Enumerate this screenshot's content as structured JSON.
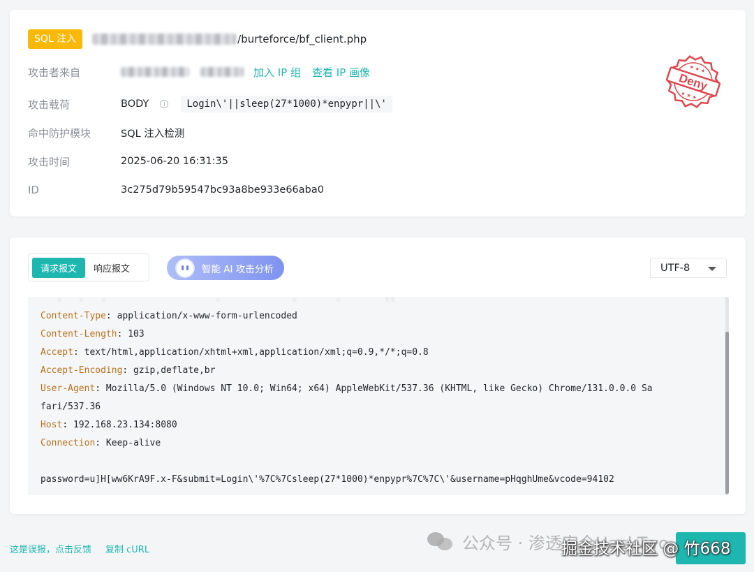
{
  "header": {
    "badge": "SQL 注入",
    "url_path": "/burteforce/bf_client.php"
  },
  "details": {
    "source": {
      "label": "攻击者来自",
      "add_ip_group": "加入 IP 组",
      "view_ip_profile": "查看 IP 画像"
    },
    "payload": {
      "label": "攻击载荷",
      "location": "BODY",
      "value": "Login\\'||sleep(27*1000)*enpypr||\\'"
    },
    "module": {
      "label": "命中防护模块",
      "value": "SQL 注入检测"
    },
    "time": {
      "label": "攻击时间",
      "value": "2025-06-20 16:31:35"
    },
    "id": {
      "label": "ID",
      "value": "3c275d79b59547bc93a8be933e66aba0"
    }
  },
  "stamp": {
    "text": "Deny",
    "color": "#e0464d"
  },
  "request_panel": {
    "tabs": [
      "请求报文",
      "响应报文"
    ],
    "active_tab": 0,
    "ai_button": "智能 AI 攻击分析",
    "encoding": "UTF-8",
    "headers": [
      {
        "key": "Content-Type",
        "value": " application/x-www-form-urlencoded"
      },
      {
        "key": "Content-Length",
        "value": " 103"
      },
      {
        "key": "Accept",
        "value": " text/html,application/xhtml+xml,application/xml;q=0.9,*/*;q=0.8"
      },
      {
        "key": "Accept-Encoding",
        "value": " gzip,deflate,br"
      },
      {
        "key": "User-Agent",
        "value": " Mozilla/5.0 (Windows NT 10.0; Win64; x64) AppleWebKit/537.36 (KHTML, like Gecko) Chrome/131.0.0.0 Sa"
      },
      {
        "key": "",
        "value": "fari/537.36"
      },
      {
        "key": "Host",
        "value": " 192.168.23.134:8080"
      },
      {
        "key": "Connection",
        "value": " Keep-alive"
      }
    ],
    "body": "password=u]H[ww6KrA9F.x-F&submit=Login\\'%7C%7Csleep(27*1000)*enpypr%7C%7C\\'&username=pHqghUme&vcode=94102"
  },
  "footer": {
    "false_positive": "这是误报，点击反馈",
    "copy_curl": "复制 cURL"
  },
  "watermark": {
    "wechat": "公众号 · 渗透安全HackTwo",
    "juejin": "掘金技术社区 @ 竹668"
  },
  "colors": {
    "accent": "#1db7b0",
    "badge": "#f9b90b",
    "header_key": "#b8721d"
  }
}
